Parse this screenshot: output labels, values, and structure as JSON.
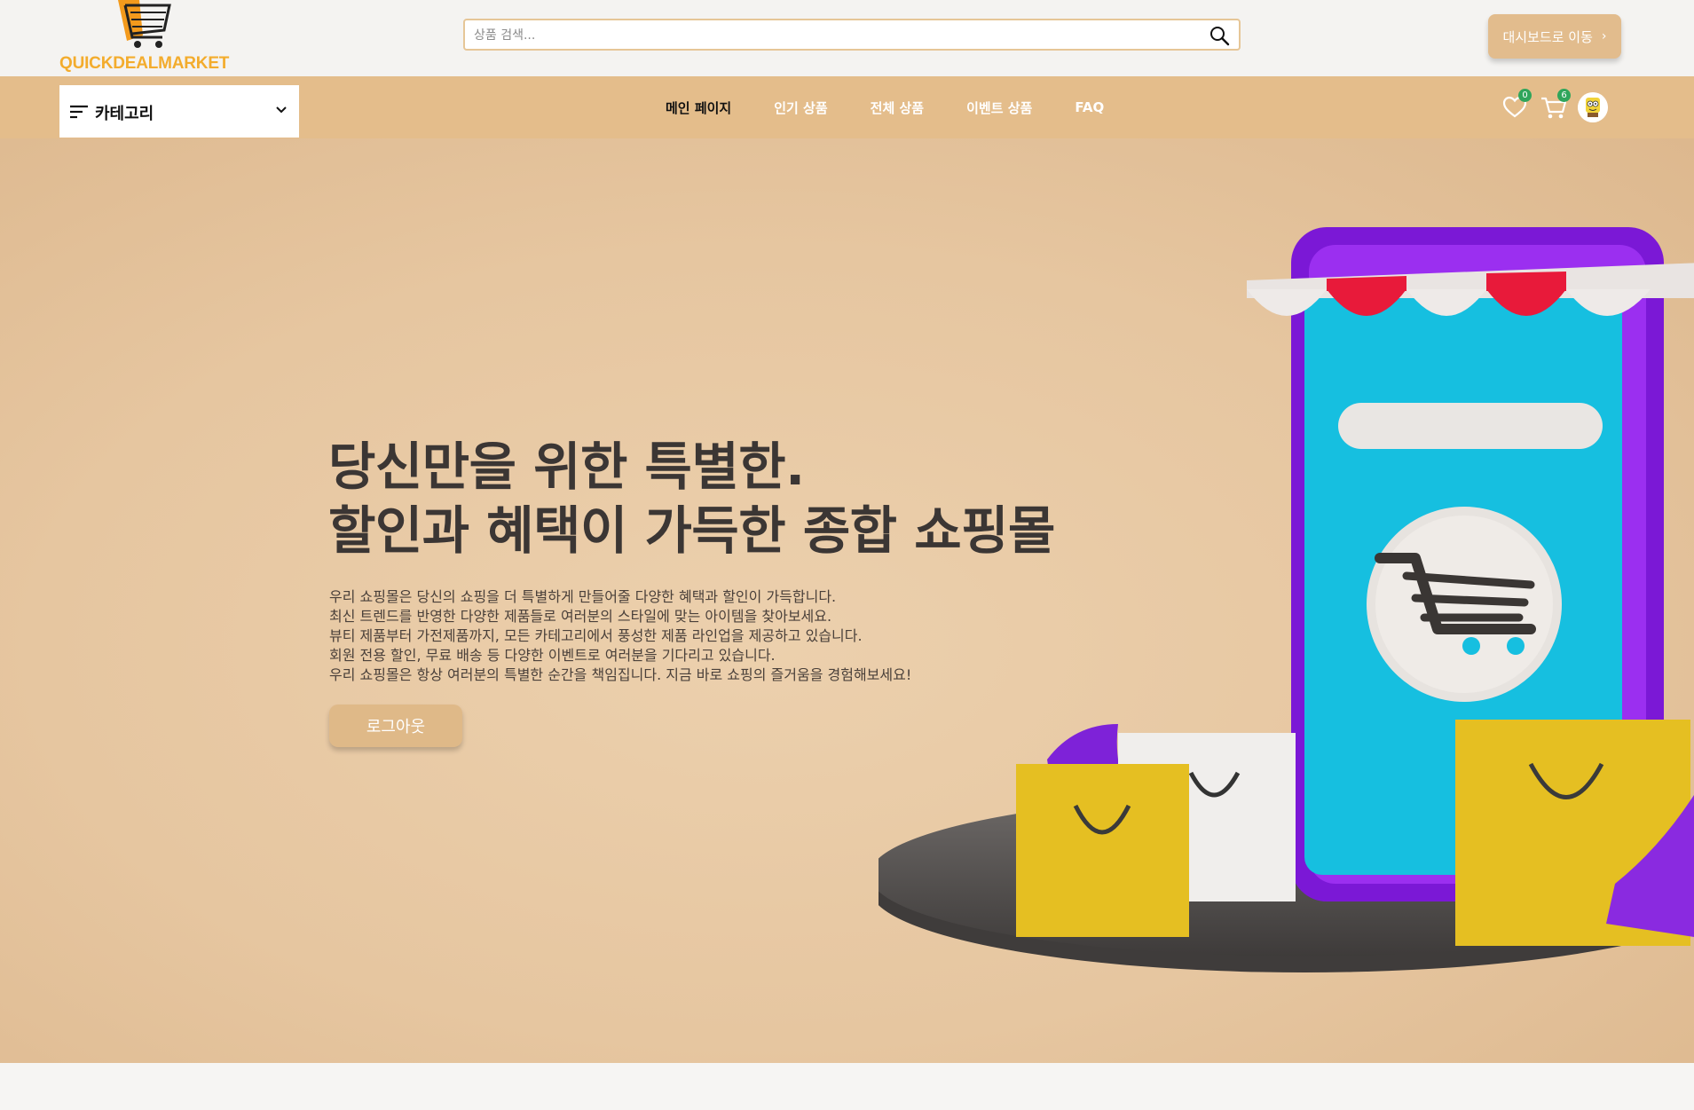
{
  "brand": {
    "name": "QUICKDEALMARKET",
    "color": "#f3ac2d"
  },
  "search": {
    "placeholder": "상품 검색..."
  },
  "header": {
    "dashboard_button": "대시보드로 이동"
  },
  "category": {
    "label": "카테고리"
  },
  "nav": {
    "links": [
      {
        "label": "메인 페이지",
        "active": true
      },
      {
        "label": "인기 상품",
        "active": false
      },
      {
        "label": "전체 상품",
        "active": false
      },
      {
        "label": "이벤트 상품",
        "active": false
      },
      {
        "label": "FAQ",
        "active": false
      }
    ],
    "wishlist_count": "0",
    "cart_count": "6"
  },
  "hero": {
    "title_line1": "당신만을 위한 특별한.",
    "title_line2": "할인과 혜택이 가득한 종합 쇼핑몰",
    "desc": [
      "우리 쇼핑몰은 당신의 쇼핑을 더 특별하게 만들어줄 다양한 혜택과 할인이 가득합니다.",
      "최신 트렌드를 반영한 다양한 제품들로 여러분의 스타일에 맞는 아이템을 찾아보세요.",
      "뷰티 제품부터 가전제품까지, 모든 카테고리에서 풍성한 제품 라인업을 제공하고 있습니다.",
      "회원 전용 할인, 무료 배송 등 다양한 이벤트로 여러분을 기다리고 있습니다.",
      "우리 쇼핑몰은 항상 여러분의 특별한 순간을 책임집니다. 지금 바로 쇼핑의 즐거움을 경험해보세요!"
    ],
    "button": "로그아웃"
  },
  "colors": {
    "nav_bg": "#e4bd8b",
    "accent": "#dfb988",
    "hero_bg": "#e6c6a0",
    "badge": "#2fa55b"
  },
  "icons": [
    "shopping-cart-logo-icon",
    "search-icon",
    "chevron-right-icon",
    "menu-lines-icon",
    "chevron-down-icon",
    "heart-icon",
    "cart-icon",
    "avatar"
  ]
}
